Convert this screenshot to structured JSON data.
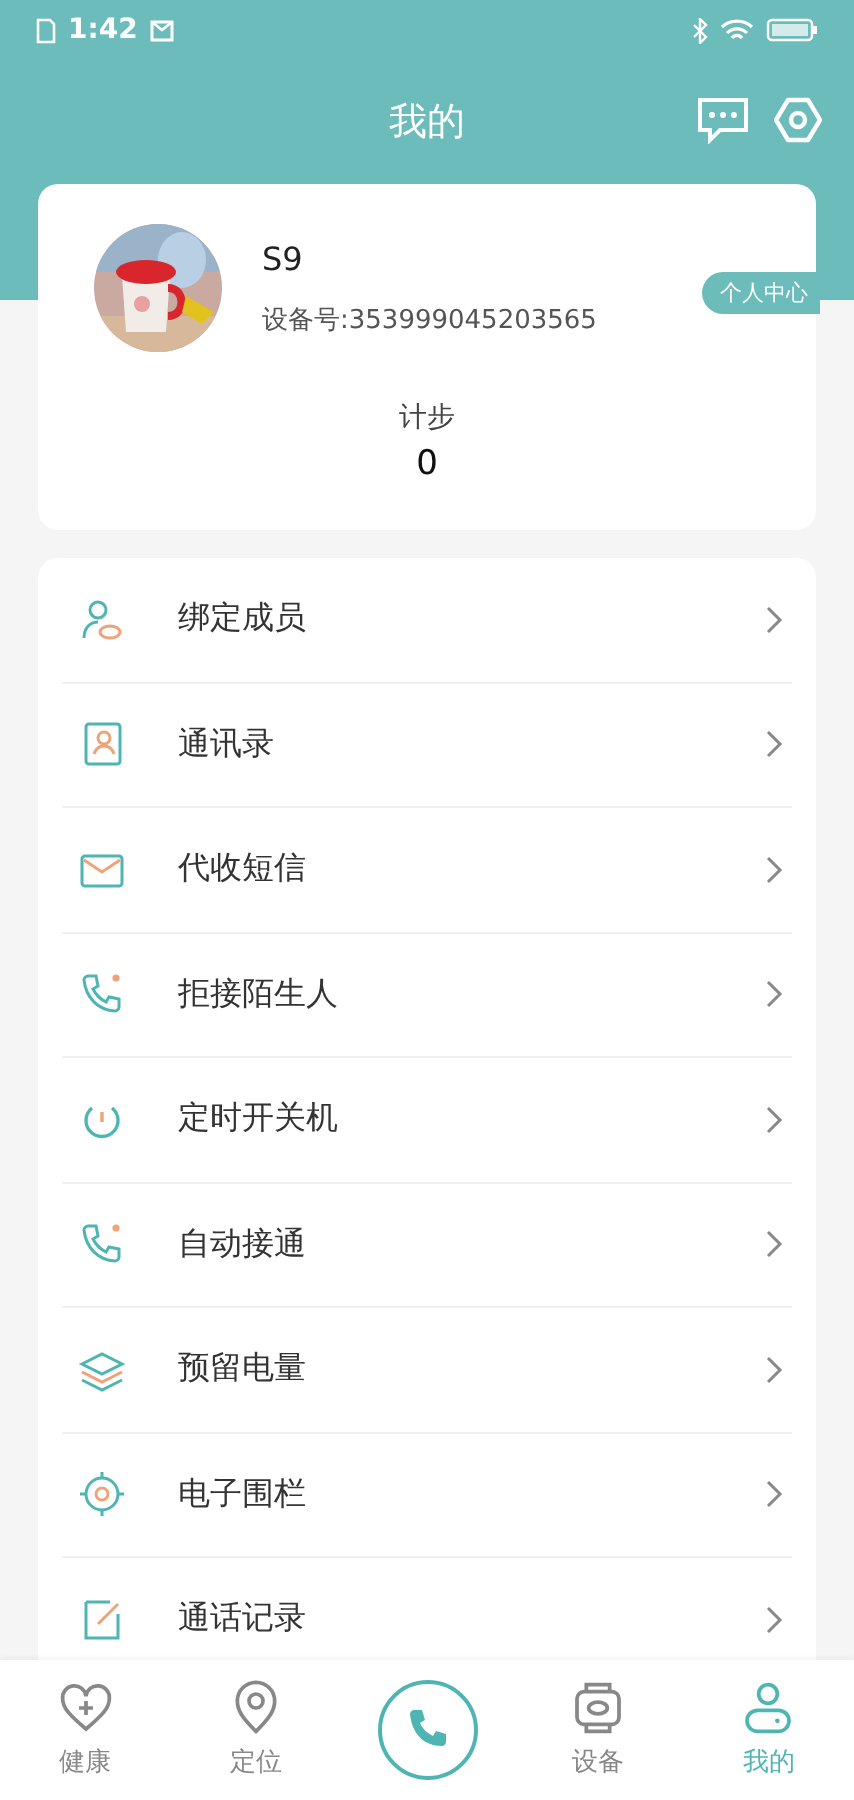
{
  "status_bar": {
    "time": "1:42"
  },
  "header": {
    "title": "我的"
  },
  "profile": {
    "name": "S9",
    "device_id": "设备号:353999045203565",
    "badge": "个人中心",
    "steps_label": "计步",
    "steps_value": "0"
  },
  "menu": [
    {
      "label": "绑定成员",
      "kind": "members"
    },
    {
      "label": "通讯录",
      "kind": "contacts"
    },
    {
      "label": "代收短信",
      "kind": "mail"
    },
    {
      "label": "拒接陌生人",
      "kind": "phone"
    },
    {
      "label": "定时开关机",
      "kind": "power"
    },
    {
      "label": "自动接通",
      "kind": "phone"
    },
    {
      "label": "预留电量",
      "kind": "layers"
    },
    {
      "label": "电子围栏",
      "kind": "fence"
    },
    {
      "label": "通话记录",
      "kind": "record"
    }
  ],
  "tab_bar": [
    {
      "label": "健康",
      "kind": "health",
      "selected": false
    },
    {
      "label": "定位",
      "kind": "location",
      "selected": false
    },
    {
      "kind": "call",
      "selected": false
    },
    {
      "label": "设备",
      "kind": "watch",
      "selected": false
    },
    {
      "label": "我的",
      "kind": "person",
      "selected": true
    }
  ]
}
